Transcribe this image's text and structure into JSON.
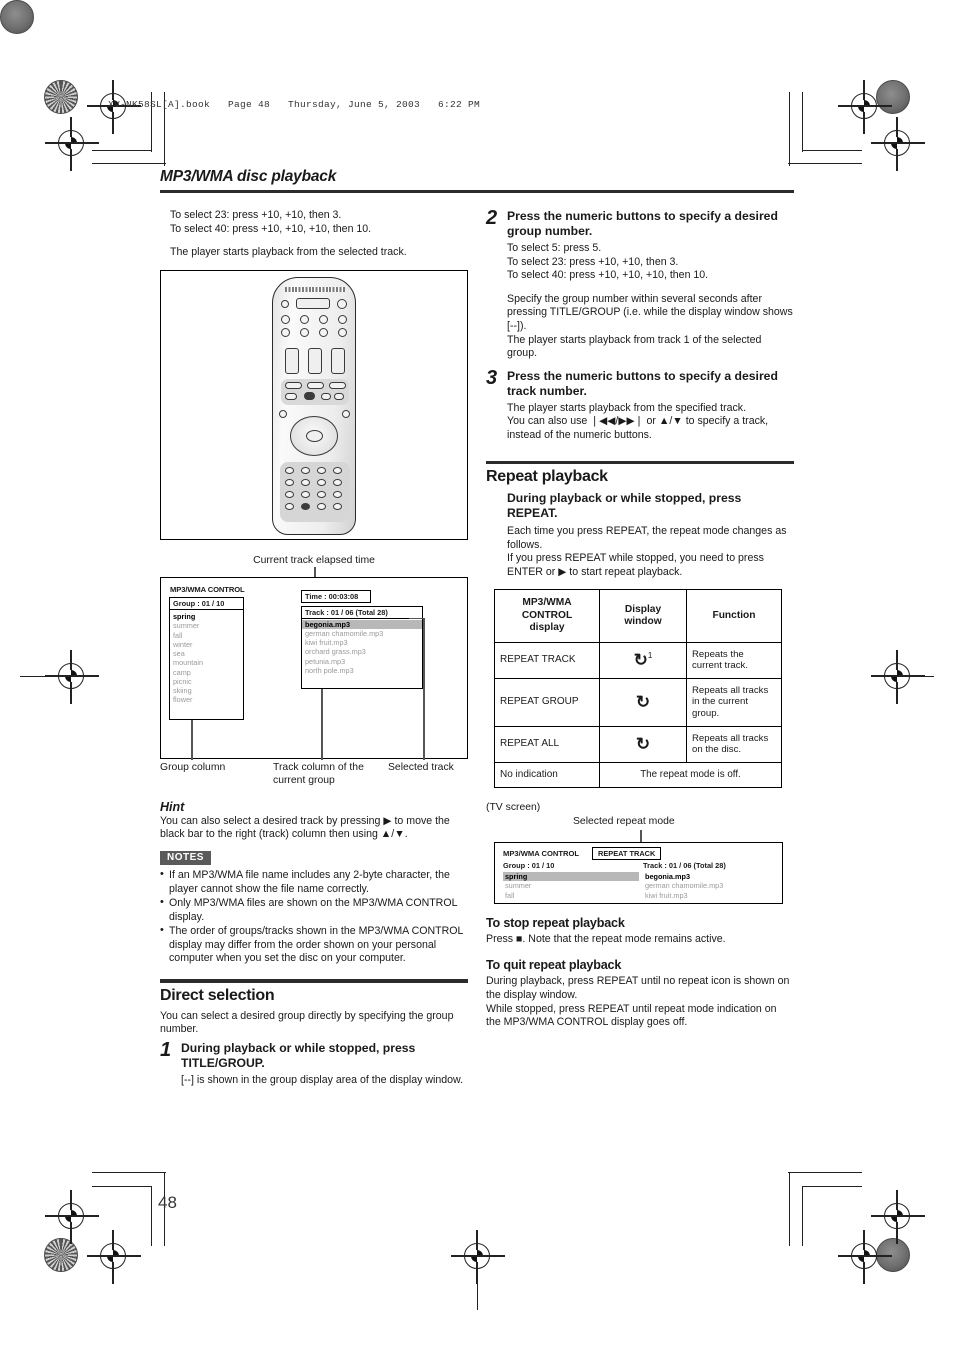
{
  "print": {
    "file_line": "XV-NK58SL[A].book   Page 48   Thursday, June 5, 2003   6:22 PM",
    "page_number": "48"
  },
  "running_head": "MP3/WMA disc playback",
  "left_column": {
    "intro_lines": [
      "To select 23: press +10, +10, then 3.",
      "To select 40: press +10, +10, +10, then 10."
    ],
    "intro_note": "The player starts playback from the selected track.",
    "diagram": {
      "top_callout": "Current track elapsed time",
      "control_title": "MP3/WMA CONTROL",
      "group_header": "Group : 01 / 10",
      "groups": [
        "spring",
        "summer",
        "fall",
        "winter",
        "sea",
        "mountain",
        "camp",
        "picnic",
        "skiing",
        "flower"
      ],
      "selected_group": "spring",
      "time_label": "Time : 00:03:08",
      "track_header": "Track : 01 / 06 (Total 28)",
      "tracks": [
        "begonia.mp3",
        "german chamomile.mp3",
        "kiwi fruit.mp3",
        "orchard grass.mp3",
        "petunia.mp3",
        "north pole.mp3"
      ],
      "selected_track": "begonia.mp3",
      "callout_group": "Group column",
      "callout_track": "Track column of the\ncurrent group",
      "callout_track_l1": "Track column of the",
      "callout_track_l2": "current group",
      "callout_selected": "Selected track"
    },
    "hint": {
      "heading": "Hint",
      "text": "You can also select a desired track by pressing ▶ to move the black bar to the right (track) column then using ▲/▼."
    },
    "notes": {
      "tag": "NOTES",
      "items": [
        "If an MP3/WMA file name includes any 2-byte character, the player cannot show the file name correctly.",
        "Only MP3/WMA files are shown on the MP3/WMA CONTROL display.",
        "The order of groups/tracks shown in the MP3/WMA CONTROL display may differ from the order shown on your personal computer when you set the disc on your computer."
      ]
    },
    "direct_selection": {
      "title": "Direct selection",
      "intro": "You can select a desired group directly by specifying the group number.",
      "step_number": "1",
      "step_title": "During playback or while stopped, press TITLE/GROUP.",
      "step_body": "[--] is shown in the group display area of the display window."
    }
  },
  "right_column": {
    "step2": {
      "number": "2",
      "title": "Press the numeric buttons to specify a desired group number.",
      "lines": [
        "To select 5: press 5.",
        "To select 23: press +10, +10, then 3.",
        "To select 40: press +10, +10, +10, then 10."
      ],
      "para1": "Specify the group number within several seconds after pressing TITLE/GROUP (i.e. while the display window shows [--]).",
      "para2": "The player starts playback from track 1 of the selected group."
    },
    "step3": {
      "number": "3",
      "title": "Press the numeric buttons to specify a desired track number.",
      "line1": "The player starts playback from the specified track.",
      "line2": "You can also use ❘◀◀/▶▶❘ or ▲/▼ to specify a track, instead of the numeric buttons."
    },
    "repeat_playback": {
      "title": "Repeat playback",
      "lead": "During playback or while stopped, press REPEAT.",
      "body1": "Each time you press REPEAT, the repeat mode changes as follows.",
      "body2": "If you press REPEAT while stopped, you need to press ENTER or ▶ to start repeat playback.",
      "table": {
        "headers": [
          "MP3/WMA CONTROL display",
          "Display window",
          "Function"
        ],
        "header_lines": [
          [
            "MP3/WMA",
            "CONTROL",
            "display"
          ],
          [
            "Display",
            "window"
          ],
          [
            "Function"
          ]
        ],
        "rows": [
          {
            "mode": "REPEAT TRACK",
            "icon": "↻",
            "icon_sup": "1",
            "function": "Repeats the current track."
          },
          {
            "mode": "REPEAT GROUP",
            "icon": "↻",
            "icon_sup": "",
            "function": "Repeats all tracks in the current group."
          },
          {
            "mode": "REPEAT ALL",
            "icon": "↻",
            "icon_sup": "",
            "function": "Repeats all tracks on the disc."
          }
        ],
        "last_row": {
          "mode": "No indication",
          "spanned": "The repeat mode is off."
        }
      },
      "tv_caption": "(TV screen)",
      "tv_callout": "Selected repeat mode",
      "tv": {
        "control_title": "MP3/WMA CONTROL",
        "mode_badge": "REPEAT TRACK",
        "group_header": "Group : 01 / 10",
        "track_header": "Track : 01 / 06 (Total 28)",
        "groups": [
          "spring",
          "summer",
          "fall"
        ],
        "tracks": [
          "begonia.mp3",
          "german chamomile.mp3",
          "kiwi fruit.mp3"
        ]
      },
      "stop": {
        "title": "To stop repeat playback",
        "text": "Press ■. Note that the repeat mode remains active."
      },
      "quit": {
        "title": "To quit repeat playback",
        "line1": "During playback, press REPEAT until no repeat icon is shown on the display window.",
        "line2": "While stopped, press REPEAT until repeat mode indication on the MP3/WMA CONTROL display goes off."
      }
    }
  }
}
